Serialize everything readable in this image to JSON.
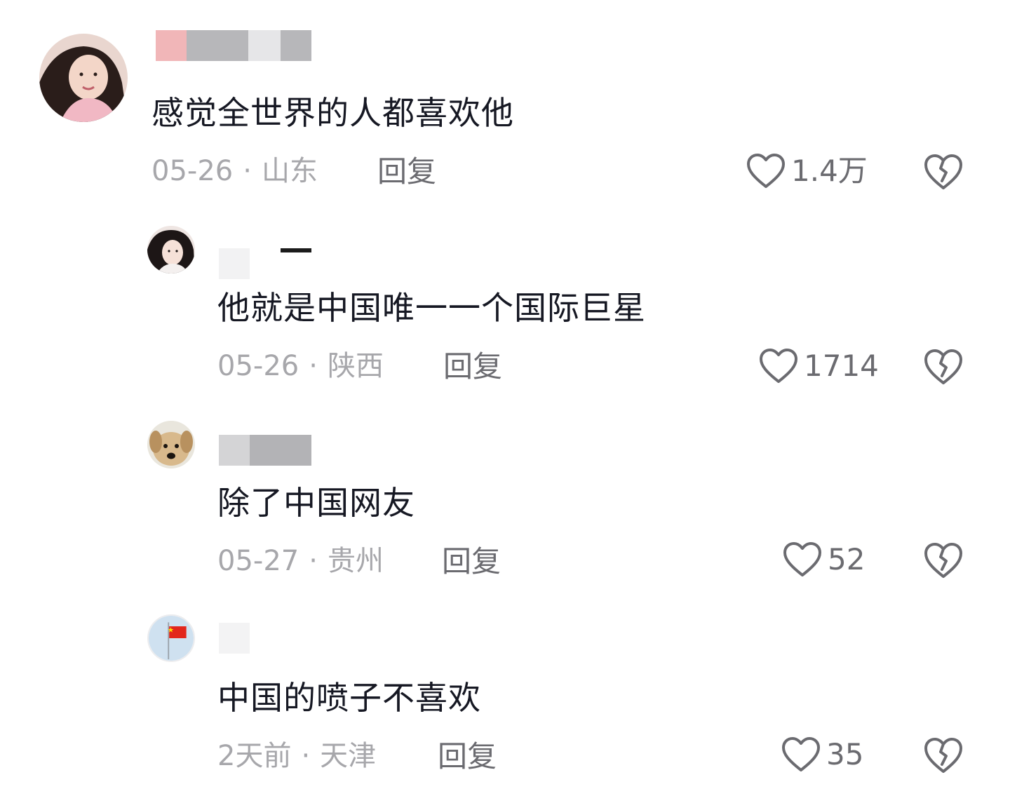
{
  "comments": [
    {
      "text": "感觉全世界的人都喜欢他",
      "date": "05-26",
      "location": "山东",
      "reply_label": "回复",
      "likes": "1.4万",
      "avatar_icon": "woman-avatar"
    },
    {
      "text": "他就是中国唯一一个国际巨星",
      "date": "05-26",
      "location": "陕西",
      "reply_label": "回复",
      "likes": "1714",
      "avatar_icon": "woman-avatar"
    },
    {
      "text": "除了中国网友",
      "date": "05-27",
      "location": "贵州",
      "reply_label": "回复",
      "likes": "52",
      "avatar_icon": "dog-avatar"
    },
    {
      "text": "中国的喷子不喜欢",
      "date": "2天前",
      "location": "天津",
      "reply_label": "回复",
      "likes": "35",
      "avatar_icon": "flag-avatar"
    }
  ],
  "separator": "·",
  "colors": {
    "text": "#161823",
    "meta": "#a7a7ab",
    "action": "#6b6b70"
  }
}
